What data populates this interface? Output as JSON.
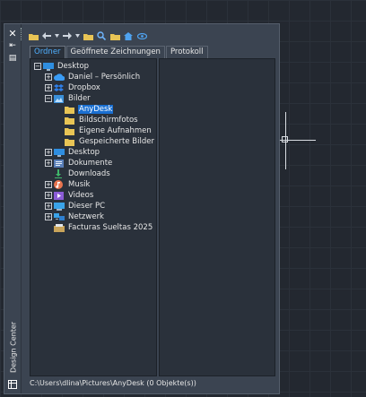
{
  "app": {
    "title": "Design Center"
  },
  "strip": {
    "close_glyph": "✕",
    "autohide_glyph": "⇤",
    "properties_glyph": "▤"
  },
  "toolbar": {
    "icons": [
      "load-icon",
      "back-icon",
      "dropdown-icon",
      "forward-icon",
      "dropdown-icon",
      "up-icon",
      "search-icon",
      "favorites-icon",
      "home-icon",
      "preview-icon"
    ]
  },
  "tabs": [
    {
      "label": "Ordner",
      "active": true
    },
    {
      "label": "Geöffnete Zeichnungen",
      "active": false
    },
    {
      "label": "Protokoll",
      "active": false
    }
  ],
  "tree": [
    {
      "label": "Desktop",
      "level": 0,
      "expander": "−",
      "icon": "desktop"
    },
    {
      "label": "Daniel – Persönlich",
      "level": 1,
      "expander": "+",
      "icon": "cloud"
    },
    {
      "label": "Dropbox",
      "level": 1,
      "expander": "+",
      "icon": "dropbox"
    },
    {
      "label": "Bilder",
      "level": 1,
      "expander": "−",
      "icon": "pictures"
    },
    {
      "label": "AnyDesk",
      "level": 2,
      "expander": "",
      "icon": "folder",
      "selected": true
    },
    {
      "label": "Bildschirmfotos",
      "level": 2,
      "expander": "",
      "icon": "folder"
    },
    {
      "label": "Eigene Aufnahmen",
      "level": 2,
      "expander": "",
      "icon": "folder"
    },
    {
      "label": "Gespeicherte Bilder",
      "level": 2,
      "expander": "",
      "icon": "folder"
    },
    {
      "label": "Desktop",
      "level": 1,
      "expander": "+",
      "icon": "desktop"
    },
    {
      "label": "Dokumente",
      "level": 1,
      "expander": "+",
      "icon": "documents"
    },
    {
      "label": "Downloads",
      "level": 1,
      "expander": "",
      "icon": "downloads"
    },
    {
      "label": "Musik",
      "level": 1,
      "expander": "+",
      "icon": "music"
    },
    {
      "label": "Videos",
      "level": 1,
      "expander": "+",
      "icon": "videos"
    },
    {
      "label": "Dieser PC",
      "level": 1,
      "expander": "+",
      "icon": "pc"
    },
    {
      "label": "Netzwerk",
      "level": 1,
      "expander": "+",
      "icon": "network"
    },
    {
      "label": "Facturas Sueltas 2025",
      "level": 1,
      "expander": "",
      "icon": "file"
    }
  ],
  "status": {
    "path": "C:\\Users\\dlina\\Pictures\\AnyDesk (0 Objekte(s))"
  },
  "colors": {
    "accent": "#1a6fd1",
    "tab_active_text": "#4fb0ff",
    "folder": "#e8c455"
  }
}
